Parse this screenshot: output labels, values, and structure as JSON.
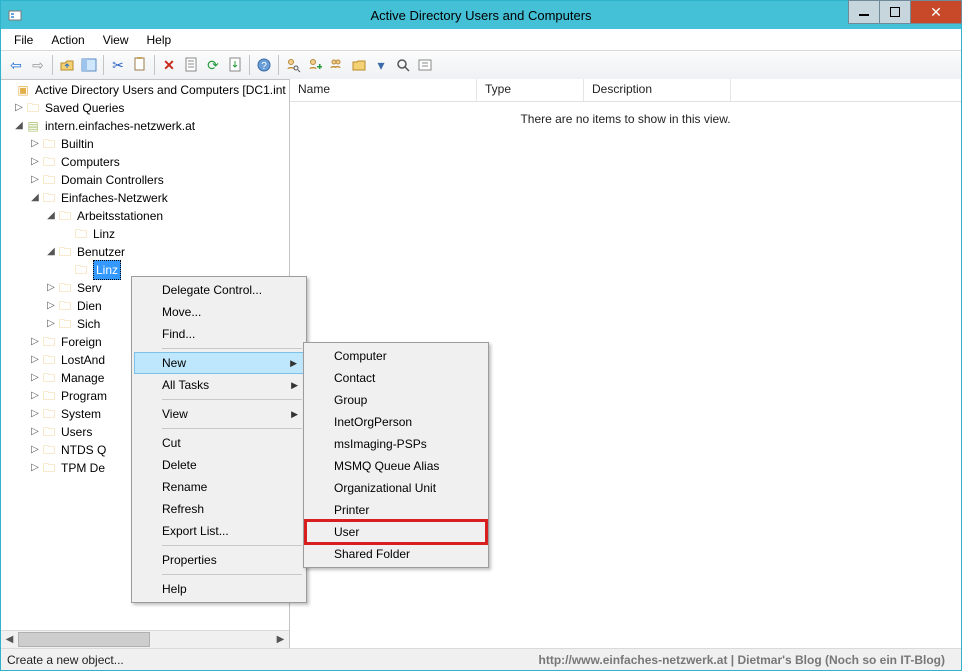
{
  "window": {
    "title": "Active Directory Users and Computers"
  },
  "menubar": {
    "file": "File",
    "action": "Action",
    "view": "View",
    "help": "Help"
  },
  "tree": {
    "root": "Active Directory Users and Computers [DC1.int",
    "saved_queries": "Saved Queries",
    "domain": "intern.einfaches-netzwerk.at",
    "builtin": "Builtin",
    "computers": "Computers",
    "domain_controllers": "Domain Controllers",
    "einfaches_netzwerk": "Einfaches-Netzwerk",
    "arbeitsstationen": "Arbeitsstationen",
    "arbeitsstationen_linz": "Linz",
    "benutzer": "Benutzer",
    "benutzer_linz": "Linz",
    "server": "Server",
    "dienste": "Dien",
    "sicherheit": "Sich",
    "foreign": "Foreign",
    "lostandfound": "LostAnd",
    "managed": "Manage",
    "program": "Program",
    "system": "System",
    "users": "Users",
    "ntds": "NTDS Q",
    "tpm": "TPM De"
  },
  "server_trunc": "Serv",
  "list": {
    "col_name": "Name",
    "col_type": "Type",
    "col_desc": "Description",
    "empty": "There are no items to show in this view."
  },
  "ctx": {
    "delegate": "Delegate Control...",
    "move": "Move...",
    "find": "Find...",
    "new": "New",
    "all_tasks": "All Tasks",
    "view": "View",
    "cut": "Cut",
    "delete": "Delete",
    "rename": "Rename",
    "refresh": "Refresh",
    "export": "Export List...",
    "properties": "Properties",
    "help": "Help"
  },
  "new_sub": {
    "computer": "Computer",
    "contact": "Contact",
    "group": "Group",
    "inetorg": "InetOrgPerson",
    "msimaging": "msImaging-PSPs",
    "msmq": "MSMQ Queue Alias",
    "ou": "Organizational Unit",
    "printer": "Printer",
    "user": "User",
    "shared_folder": "Shared Folder"
  },
  "status": {
    "text": "Create a new object...",
    "hint": "http://www.einfaches-netzwerk.at | Dietmar's Blog (Noch so ein IT-Blog)"
  }
}
